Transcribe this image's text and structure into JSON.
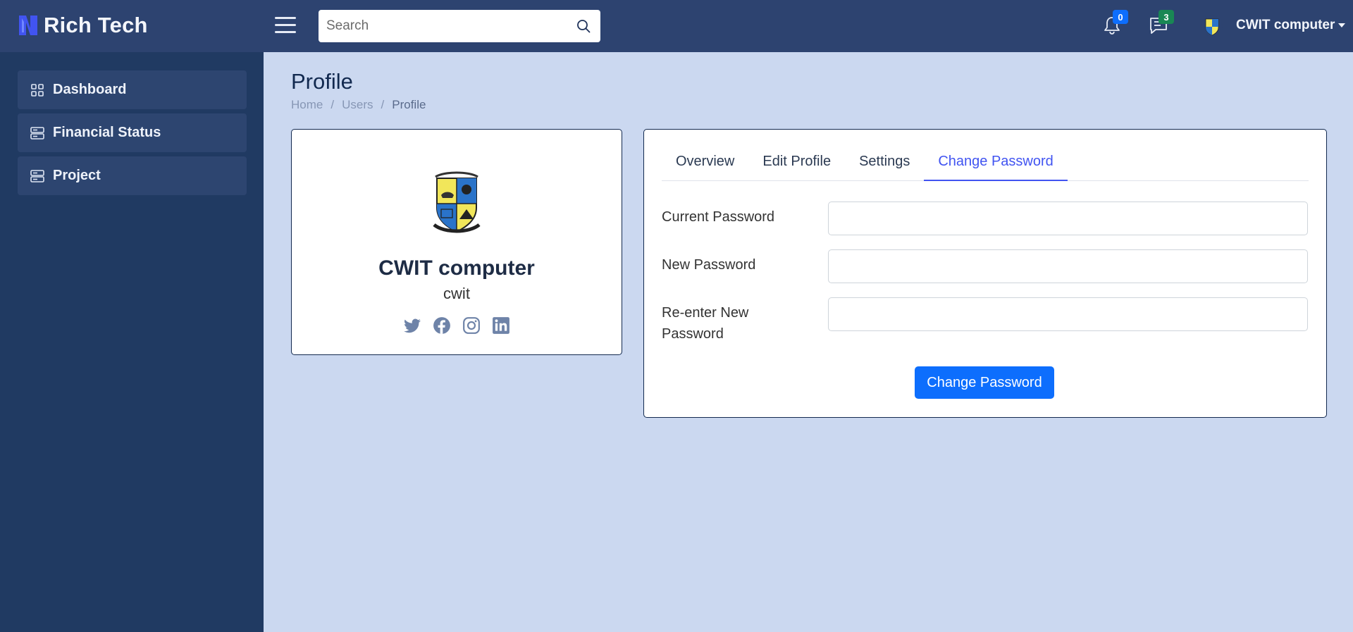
{
  "app": {
    "brand": "Rich Tech"
  },
  "header": {
    "search": {
      "placeholder": "Search",
      "value": ""
    },
    "notifications": {
      "count": "0",
      "badge_color": "#0d6efd"
    },
    "messages": {
      "count": "3",
      "badge_color": "#198754"
    },
    "user": {
      "name": "CWIT computer"
    }
  },
  "sidebar": {
    "items": [
      {
        "label": "Dashboard",
        "icon": "grid-icon"
      },
      {
        "label": "Financial Status",
        "icon": "server-icon"
      },
      {
        "label": "Project",
        "icon": "server-icon"
      }
    ]
  },
  "page": {
    "title": "Profile",
    "breadcrumb": [
      "Home",
      "Users",
      "Profile"
    ]
  },
  "profile": {
    "name": "CWIT computer",
    "username": "cwit",
    "socials": [
      "twitter-icon",
      "facebook-icon",
      "instagram-icon",
      "linkedin-icon"
    ]
  },
  "tabs": [
    "Overview",
    "Edit Profile",
    "Settings",
    "Change Password"
  ],
  "active_tab": "Change Password",
  "form": {
    "current_password_label": "Current Password",
    "new_password_label": "New Password",
    "renew_password_label_line1": "Re-enter New",
    "renew_password_label_line2": "Password",
    "submit_label": "Change Password"
  },
  "colors": {
    "accent": "#4154f1",
    "primary_button": "#0d6efd",
    "header": "#2d4370",
    "sidebar": "#203a62"
  }
}
